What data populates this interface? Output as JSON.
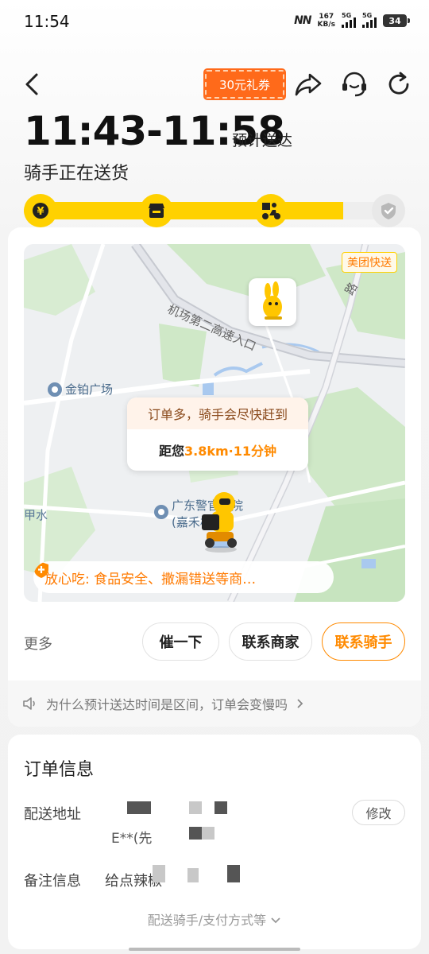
{
  "status_bar": {
    "time": "11:54",
    "network_speed_value": "167",
    "network_speed_unit": "KB/s",
    "sim1_label": "5G",
    "sim2_label": "5G",
    "battery": "34"
  },
  "header": {
    "coupon_label": "30元礼券",
    "eta_time": "11:43-11:58",
    "eta_suffix": "预计送达",
    "status": "骑手正在送货"
  },
  "progress": {
    "fraction": 0.84,
    "steps": [
      "paid-icon",
      "merchant-icon",
      "rider-icon",
      "delivered-icon"
    ]
  },
  "map": {
    "brand_label": "美团快送",
    "road_label": "机场第二高速入口",
    "road_label_2": "路",
    "poi_1": "金铂广场",
    "poi_2": "广东警官学院",
    "poi_2_sub": "(嘉禾校区)",
    "place_3": "甲水",
    "tip_line": "订单多，骑手会尽快赶到",
    "distance_prefix": "距您",
    "distance_value": "3.8km·11分钟",
    "safety_text": "放心吃: 食品安全、撒漏错送等商…"
  },
  "actions": {
    "more_label": "更多",
    "urge_label": "催一下",
    "contact_merchant_label": "联系商家",
    "contact_rider_label": "联系骑手"
  },
  "faq_text": "为什么预计送达时间是区间，订单会变慢吗",
  "order": {
    "title": "订单信息",
    "address_label": "配送地址",
    "address_fragment": "E**(先",
    "edit_label": "修改",
    "note_label": "备注信息",
    "note_value": "给点辣椒",
    "expand_label": "配送骑手/支付方式等"
  },
  "colors": {
    "brand_yellow": "#ffd100",
    "accent_orange": "#ff8a00",
    "coupon_orange": "#ff6a1a"
  }
}
